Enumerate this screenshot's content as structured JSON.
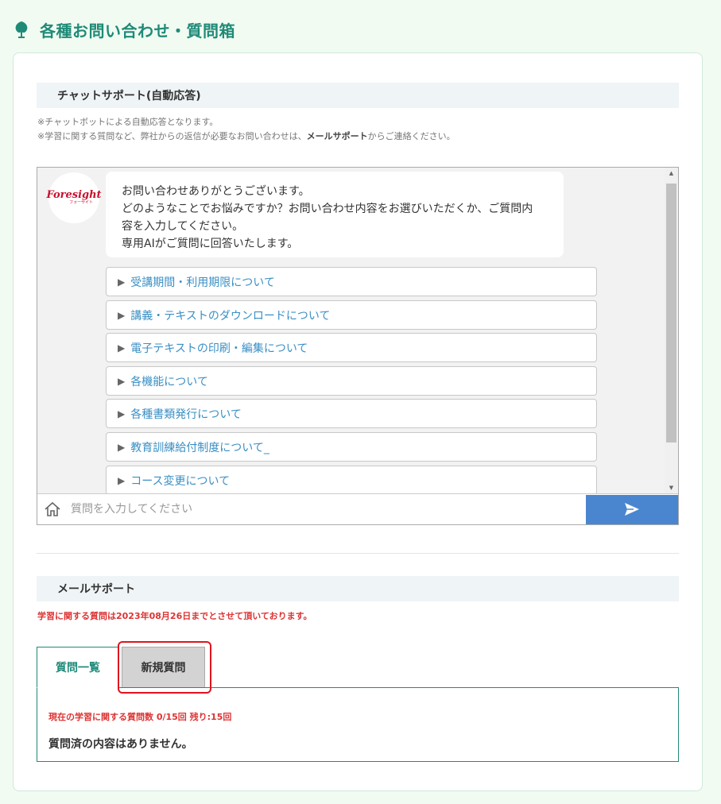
{
  "page": {
    "title": "各種お問い合わせ・質問箱",
    "accent": "#1f8a78"
  },
  "chat_section": {
    "title": "チャットサポート(自動応答)",
    "note1": "※チャットボットによる自動応答となります。",
    "note2_pre": "※学習に関する質問など、弊社からの返信が必要なお問い合わせは、",
    "note2_link": "メールサポート",
    "note2_post": "からご連絡ください。"
  },
  "chat": {
    "logo_text": "Foresight",
    "logo_sub": "フォーサイト",
    "bubble": {
      "line1": "お問い合わせありがとうございます。",
      "line2": "どのようなことでお悩みですか？お問い合わせ内容をお選びいただくか、ご質問内",
      "line3": "容を入力してください。",
      "line4": "専用AIがご質問に回答いたします。"
    },
    "options": [
      "受講期間・利用期限について",
      "講義・テキストのダウンロードについて",
      "電子テキストの印刷・編集について",
      "各機能について",
      "各種書類発行について",
      "教育訓練給付制度について_",
      "コース変更について"
    ],
    "input_placeholder": "質問を入力してください",
    "send_color": "#4a86cf"
  },
  "mail_section": {
    "title": "メールサポート",
    "note": "学習に関する質問は2023年08月26日までとさせて頂いております。",
    "tabs": {
      "list": "質問一覧",
      "new": "新規質問"
    },
    "count_text": "現在の学習に関する質問数  0/15回 残り:15回",
    "empty_text": "質問済の内容はありません。"
  }
}
